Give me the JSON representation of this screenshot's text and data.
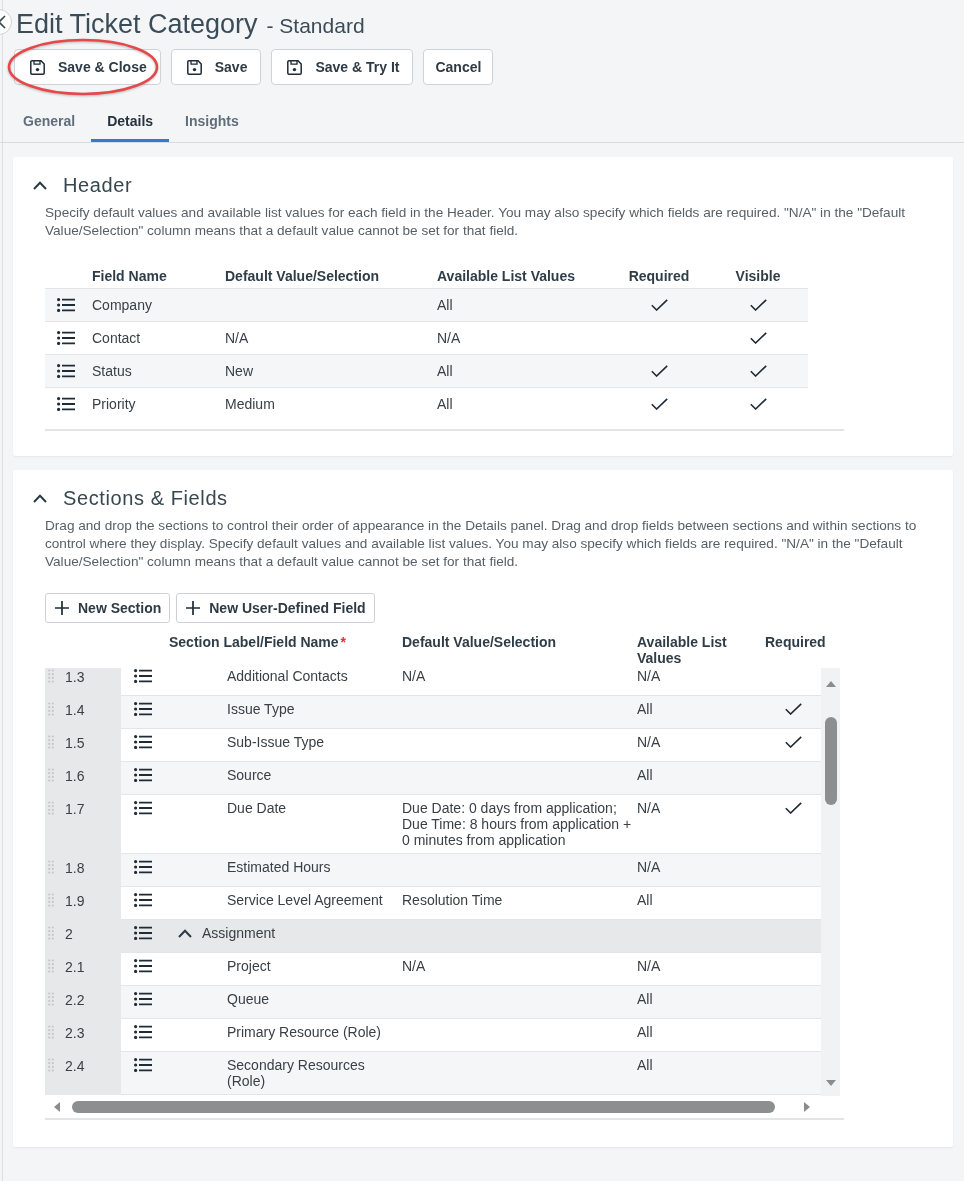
{
  "page": {
    "title": "Edit Ticket Category",
    "subtitle": "- Standard"
  },
  "toolbar": [
    {
      "label": "Save & Close",
      "kind": "icon_button",
      "highlighted": true
    },
    {
      "label": "Save",
      "kind": "icon_button",
      "highlighted": false
    },
    {
      "label": "Save & Try It",
      "kind": "icon_button",
      "highlighted": false
    },
    {
      "label": "Cancel",
      "kind": "text_button",
      "highlighted": false
    }
  ],
  "tabs": [
    {
      "label": "General",
      "selected": false
    },
    {
      "label": "Details",
      "selected": true
    },
    {
      "label": "Insights",
      "selected": false
    }
  ],
  "header_panel": {
    "title": "Header",
    "expanded": true,
    "description": "Specify default values and available list values for each field in the Header. You may also specify which fields are required. \"N/A\" in the \"Default Value/Selection\" column means that a default value cannot be set for that field.",
    "columns": [
      "Field Name",
      "Default Value/Selection",
      "Available List Values",
      "Required",
      "Visible"
    ],
    "rows": [
      {
        "field_name": "Company",
        "available_list_values": "All",
        "required": true,
        "visible": true
      },
      {
        "field_name": "Contact",
        "default_value": "N/A",
        "available_list_values": "N/A",
        "required": false,
        "visible": true
      },
      {
        "field_name": "Status",
        "default_value": "New",
        "available_list_values": "All",
        "required": true,
        "visible": true
      },
      {
        "field_name": "Priority",
        "default_value": "Medium",
        "available_list_values": "All",
        "required": true,
        "visible": true
      }
    ]
  },
  "sections_panel": {
    "title": "Sections & Fields",
    "expanded": true,
    "description": "Drag and drop the sections to control their order of appearance in the Details panel. Drag and drop fields between sections and within sections to control where they display. Specify default values and available list values. You may also specify which fields are required. \"N/A\" in the \"Default Value/Selection\" column means that a default value cannot be set for that field.",
    "buttons": [
      "New Section",
      "New User-Defined Field"
    ],
    "columns": [
      {
        "label": "Section Label/Field Name",
        "required_marker": "*"
      },
      {
        "label": "Default Value/Selection"
      },
      {
        "label": "Available List Values"
      },
      {
        "label": "Required"
      }
    ],
    "rows": [
      {
        "kind": "field",
        "number": "1.3",
        "name": "Additional Contacts",
        "default_value": "N/A",
        "available_list_values": "N/A",
        "required": false
      },
      {
        "kind": "field",
        "number": "1.4",
        "name": "Issue Type",
        "available_list_values": "All",
        "required": true
      },
      {
        "kind": "field",
        "number": "1.5",
        "name": "Sub-Issue Type",
        "available_list_values": "N/A",
        "required": true
      },
      {
        "kind": "field",
        "number": "1.6",
        "name": "Source",
        "available_list_values": "All",
        "required": false
      },
      {
        "kind": "field",
        "number": "1.7",
        "name": "Due Date",
        "default_value": "Due Date: 0 days from application; Due Time: 8 hours from application + 0 minutes from application",
        "available_list_values": "N/A",
        "required": true
      },
      {
        "kind": "field",
        "number": "1.8",
        "name": "Estimated Hours",
        "available_list_values": "N/A",
        "required": false
      },
      {
        "kind": "field",
        "number": "1.9",
        "name": "Service Level Agreement",
        "default_value": "Resolution Time",
        "available_list_values": "All",
        "required": false
      },
      {
        "kind": "section",
        "number": "2",
        "name": "Assignment",
        "expanded": true
      },
      {
        "kind": "field",
        "number": "2.1",
        "name": "Project",
        "default_value": "N/A",
        "available_list_values": "N/A",
        "required": false
      },
      {
        "kind": "field",
        "number": "2.2",
        "name": "Queue",
        "available_list_values": "All",
        "required": false
      },
      {
        "kind": "field",
        "number": "2.3",
        "name": "Primary Resource (Role)",
        "available_list_values": "All",
        "required": false
      },
      {
        "kind": "field",
        "number": "2.4",
        "name": "Secondary Resources (Role)",
        "available_list_values": "All",
        "required": false
      }
    ]
  }
}
